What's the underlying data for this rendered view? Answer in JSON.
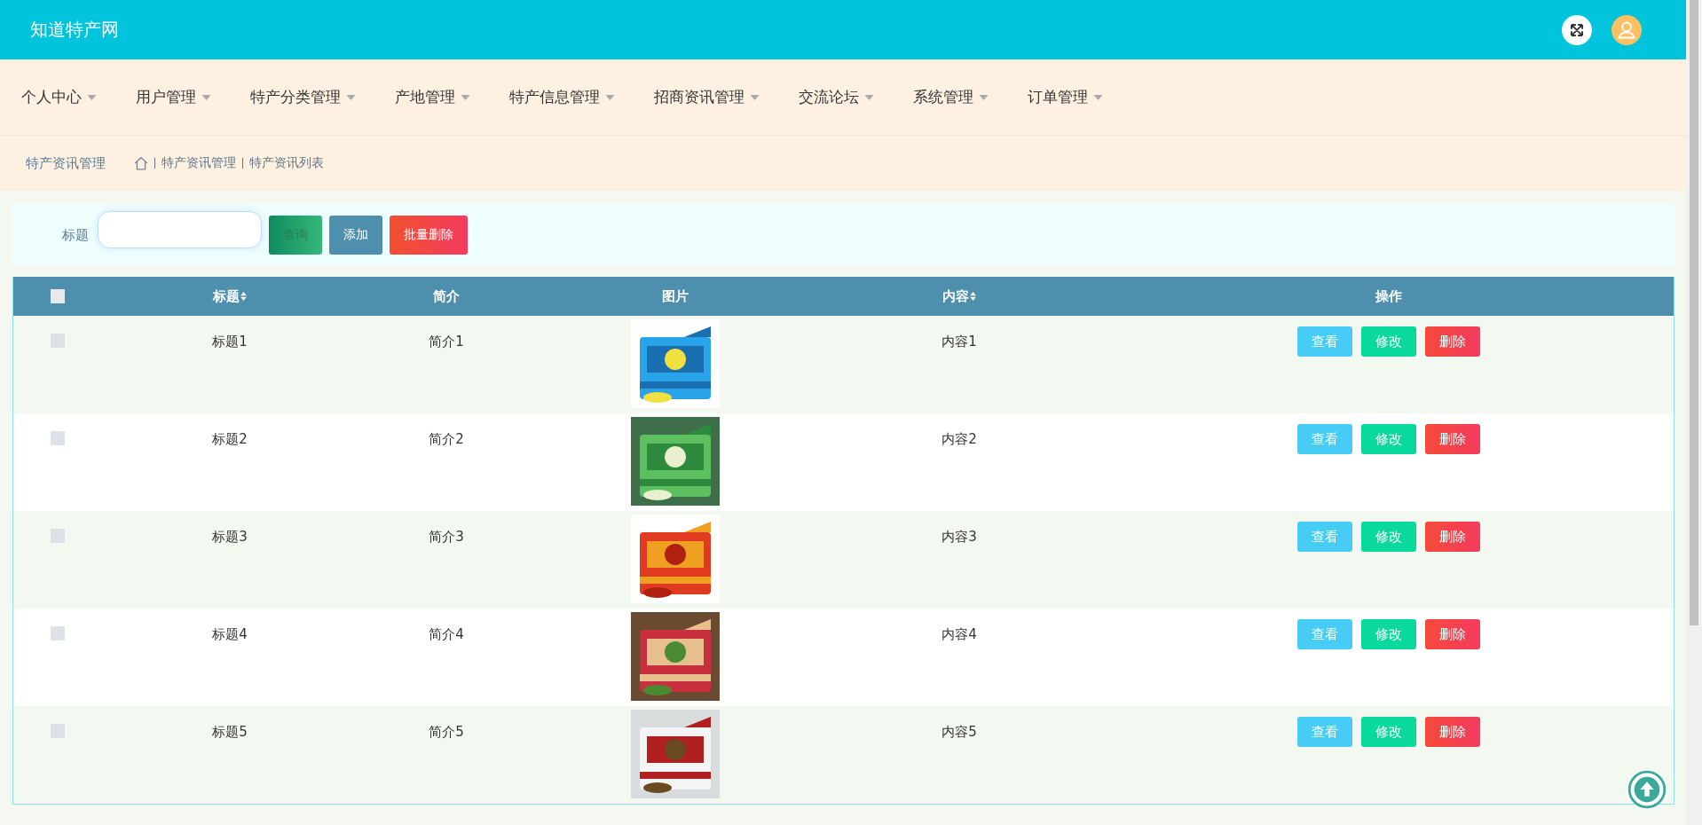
{
  "header": {
    "title": "知道特产网"
  },
  "nav": [
    {
      "label": "个人中心"
    },
    {
      "label": "用户管理"
    },
    {
      "label": "特产分类管理"
    },
    {
      "label": "产地管理"
    },
    {
      "label": "特产信息管理"
    },
    {
      "label": "招商资讯管理"
    },
    {
      "label": "交流论坛"
    },
    {
      "label": "系统管理"
    },
    {
      "label": "订单管理"
    }
  ],
  "breadcrumb": {
    "title": "特产资讯管理",
    "items": [
      "特产资讯管理",
      "特产资讯列表"
    ]
  },
  "search": {
    "label": "标题",
    "buttons": [
      {
        "label": "查询",
        "kind": "search"
      },
      {
        "label": "添加",
        "kind": "add"
      },
      {
        "label": "批量删除",
        "kind": "delete"
      }
    ]
  },
  "table": {
    "select_all_checked": false,
    "columns": [
      {
        "label": "标题",
        "sortable": true
      },
      {
        "label": "简介",
        "sortable": false
      },
      {
        "label": "图片",
        "sortable": false
      },
      {
        "label": "内容",
        "sortable": true
      },
      {
        "label": "操作",
        "sortable": false
      }
    ],
    "rows": [
      {
        "checked": false,
        "title": "标题1",
        "summary": "简介1",
        "content": "内容1",
        "actions": [
          {
            "label": "查看",
            "kind": "view"
          },
          {
            "label": "修改",
            "kind": "edit"
          },
          {
            "label": "删除",
            "kind": "delete"
          }
        ]
      },
      {
        "checked": false,
        "title": "标题2",
        "summary": "简介2",
        "content": "内容2",
        "actions": [
          {
            "label": "查看",
            "kind": "view"
          },
          {
            "label": "修改",
            "kind": "edit"
          },
          {
            "label": "删除",
            "kind": "delete"
          }
        ]
      },
      {
        "checked": false,
        "title": "标题3",
        "summary": "简介3",
        "content": "内容3",
        "actions": [
          {
            "label": "查看",
            "kind": "view"
          },
          {
            "label": "修改",
            "kind": "edit"
          },
          {
            "label": "删除",
            "kind": "delete"
          }
        ]
      },
      {
        "checked": false,
        "title": "标题4",
        "summary": "简介4",
        "content": "内容4",
        "actions": [
          {
            "label": "查看",
            "kind": "view"
          },
          {
            "label": "修改",
            "kind": "edit"
          },
          {
            "label": "删除",
            "kind": "delete"
          }
        ]
      },
      {
        "checked": false,
        "title": "标题5",
        "summary": "简介5",
        "content": "内容5",
        "actions": [
          {
            "label": "查看",
            "kind": "view"
          },
          {
            "label": "修改",
            "kind": "edit"
          },
          {
            "label": "删除",
            "kind": "delete"
          }
        ]
      }
    ]
  }
}
